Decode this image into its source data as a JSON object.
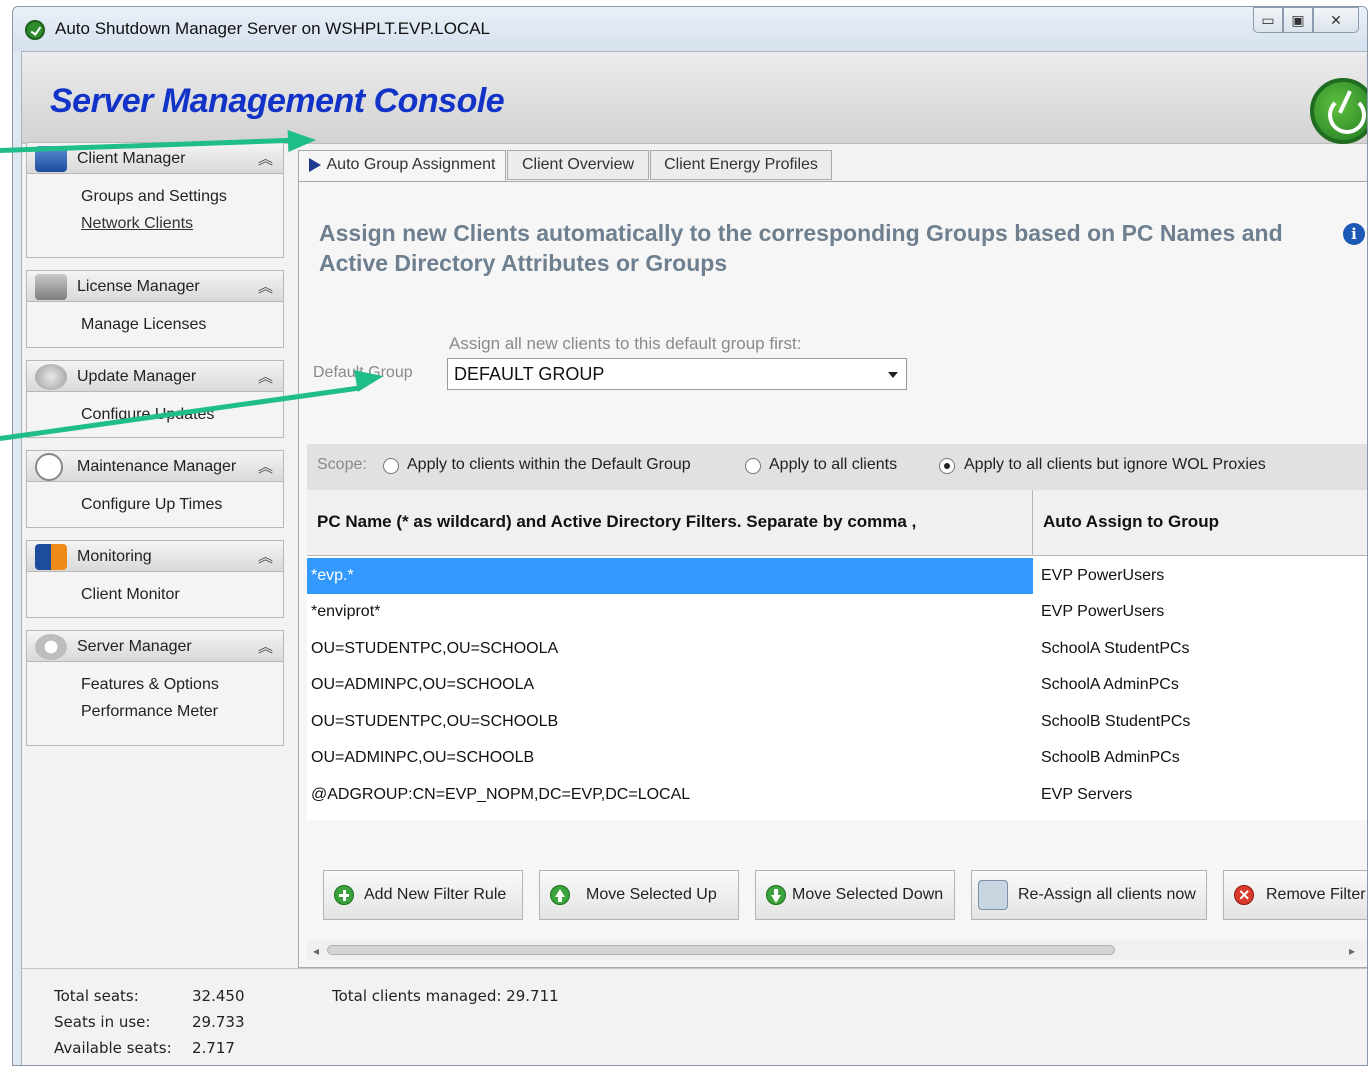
{
  "window": {
    "title": "Auto Shutdown Manager Server on WSHPLT.EVP.LOCAL",
    "controls": [
      "minimize",
      "maximize",
      "close"
    ]
  },
  "header": {
    "title": "Server Management Console"
  },
  "sidebar": {
    "groups": [
      {
        "label": "Client Manager",
        "icon": "monitor-icon",
        "items": [
          "Groups and Settings",
          "Network Clients"
        ]
      },
      {
        "label": "License Manager",
        "icon": "license-icon",
        "items": [
          "Manage Licenses"
        ]
      },
      {
        "label": "Update  Manager",
        "icon": "update-icon",
        "items": [
          "Configure Updates"
        ]
      },
      {
        "label": "Maintenance Manager",
        "icon": "clock-icon",
        "items": [
          "Configure Up Times"
        ]
      },
      {
        "label": "Monitoring",
        "icon": "monitoring-icon",
        "items": [
          "Client Monitor"
        ]
      },
      {
        "label": "Server Manager",
        "icon": "gear-icon",
        "items": [
          "Features & Options",
          "Performance Meter"
        ]
      }
    ]
  },
  "tabs": [
    {
      "label": "Auto Group Assignment",
      "active": true
    },
    {
      "label": "Client Overview",
      "active": false
    },
    {
      "label": "Client Energy Profiles",
      "active": false
    }
  ],
  "panel": {
    "headline": "Assign new Clients automatically to the corresponding Groups based on PC Names and Active Directory Attributes or Groups",
    "default_group_hint": "Assign all new clients to this default group first:",
    "default_group_label": "Default Group",
    "default_group_value": "DEFAULT GROUP",
    "scope": {
      "label": "Scope:",
      "options": [
        {
          "label": "Apply to clients within the Default Group",
          "checked": false
        },
        {
          "label": "Apply to all clients",
          "checked": false
        },
        {
          "label": "Apply to all clients but ignore WOL Proxies",
          "checked": true
        }
      ]
    },
    "table": {
      "columns": [
        "PC Name (* as wildcard) and Active Directory Filters. Separate by comma ,",
        "Auto Assign to Group"
      ],
      "rows": [
        {
          "filter": "*evp.*",
          "group": "EVP PowerUsers",
          "selected": true
        },
        {
          "filter": "*enviprot*",
          "group": "EVP PowerUsers",
          "selected": false
        },
        {
          "filter": "OU=STUDENTPC,OU=SCHOOLA",
          "group": "SchoolA StudentPCs",
          "selected": false
        },
        {
          "filter": "OU=ADMINPC,OU=SCHOOLA",
          "group": "SchoolA AdminPCs",
          "selected": false
        },
        {
          "filter": "OU=STUDENTPC,OU=SCHOOLB",
          "group": "SchoolB StudentPCs",
          "selected": false
        },
        {
          "filter": "OU=ADMINPC,OU=SCHOOLB",
          "group": "SchoolB AdminPCs",
          "selected": false
        },
        {
          "filter": "@ADGROUP:CN=EVP_NOPM,DC=EVP,DC=LOCAL",
          "group": "EVP Servers",
          "selected": false
        }
      ]
    },
    "buttons": {
      "add": "Add New Filter Rule",
      "up": "Move Selected Up",
      "down": "Move Selected Down",
      "reassign": "Re-Assign all clients now",
      "remove": "Remove Filter"
    }
  },
  "status": {
    "total_seats_label": "Total seats:",
    "total_seats": "32.450",
    "seats_in_use_label": "Seats in use:",
    "seats_in_use": "29.733",
    "available_label": "Available seats:",
    "available": "2.717",
    "total_clients": "Total clients managed: 29.711"
  },
  "colors": {
    "accent": "#1233c8",
    "selection": "#3399ff",
    "callout": "#1fbd8a"
  }
}
